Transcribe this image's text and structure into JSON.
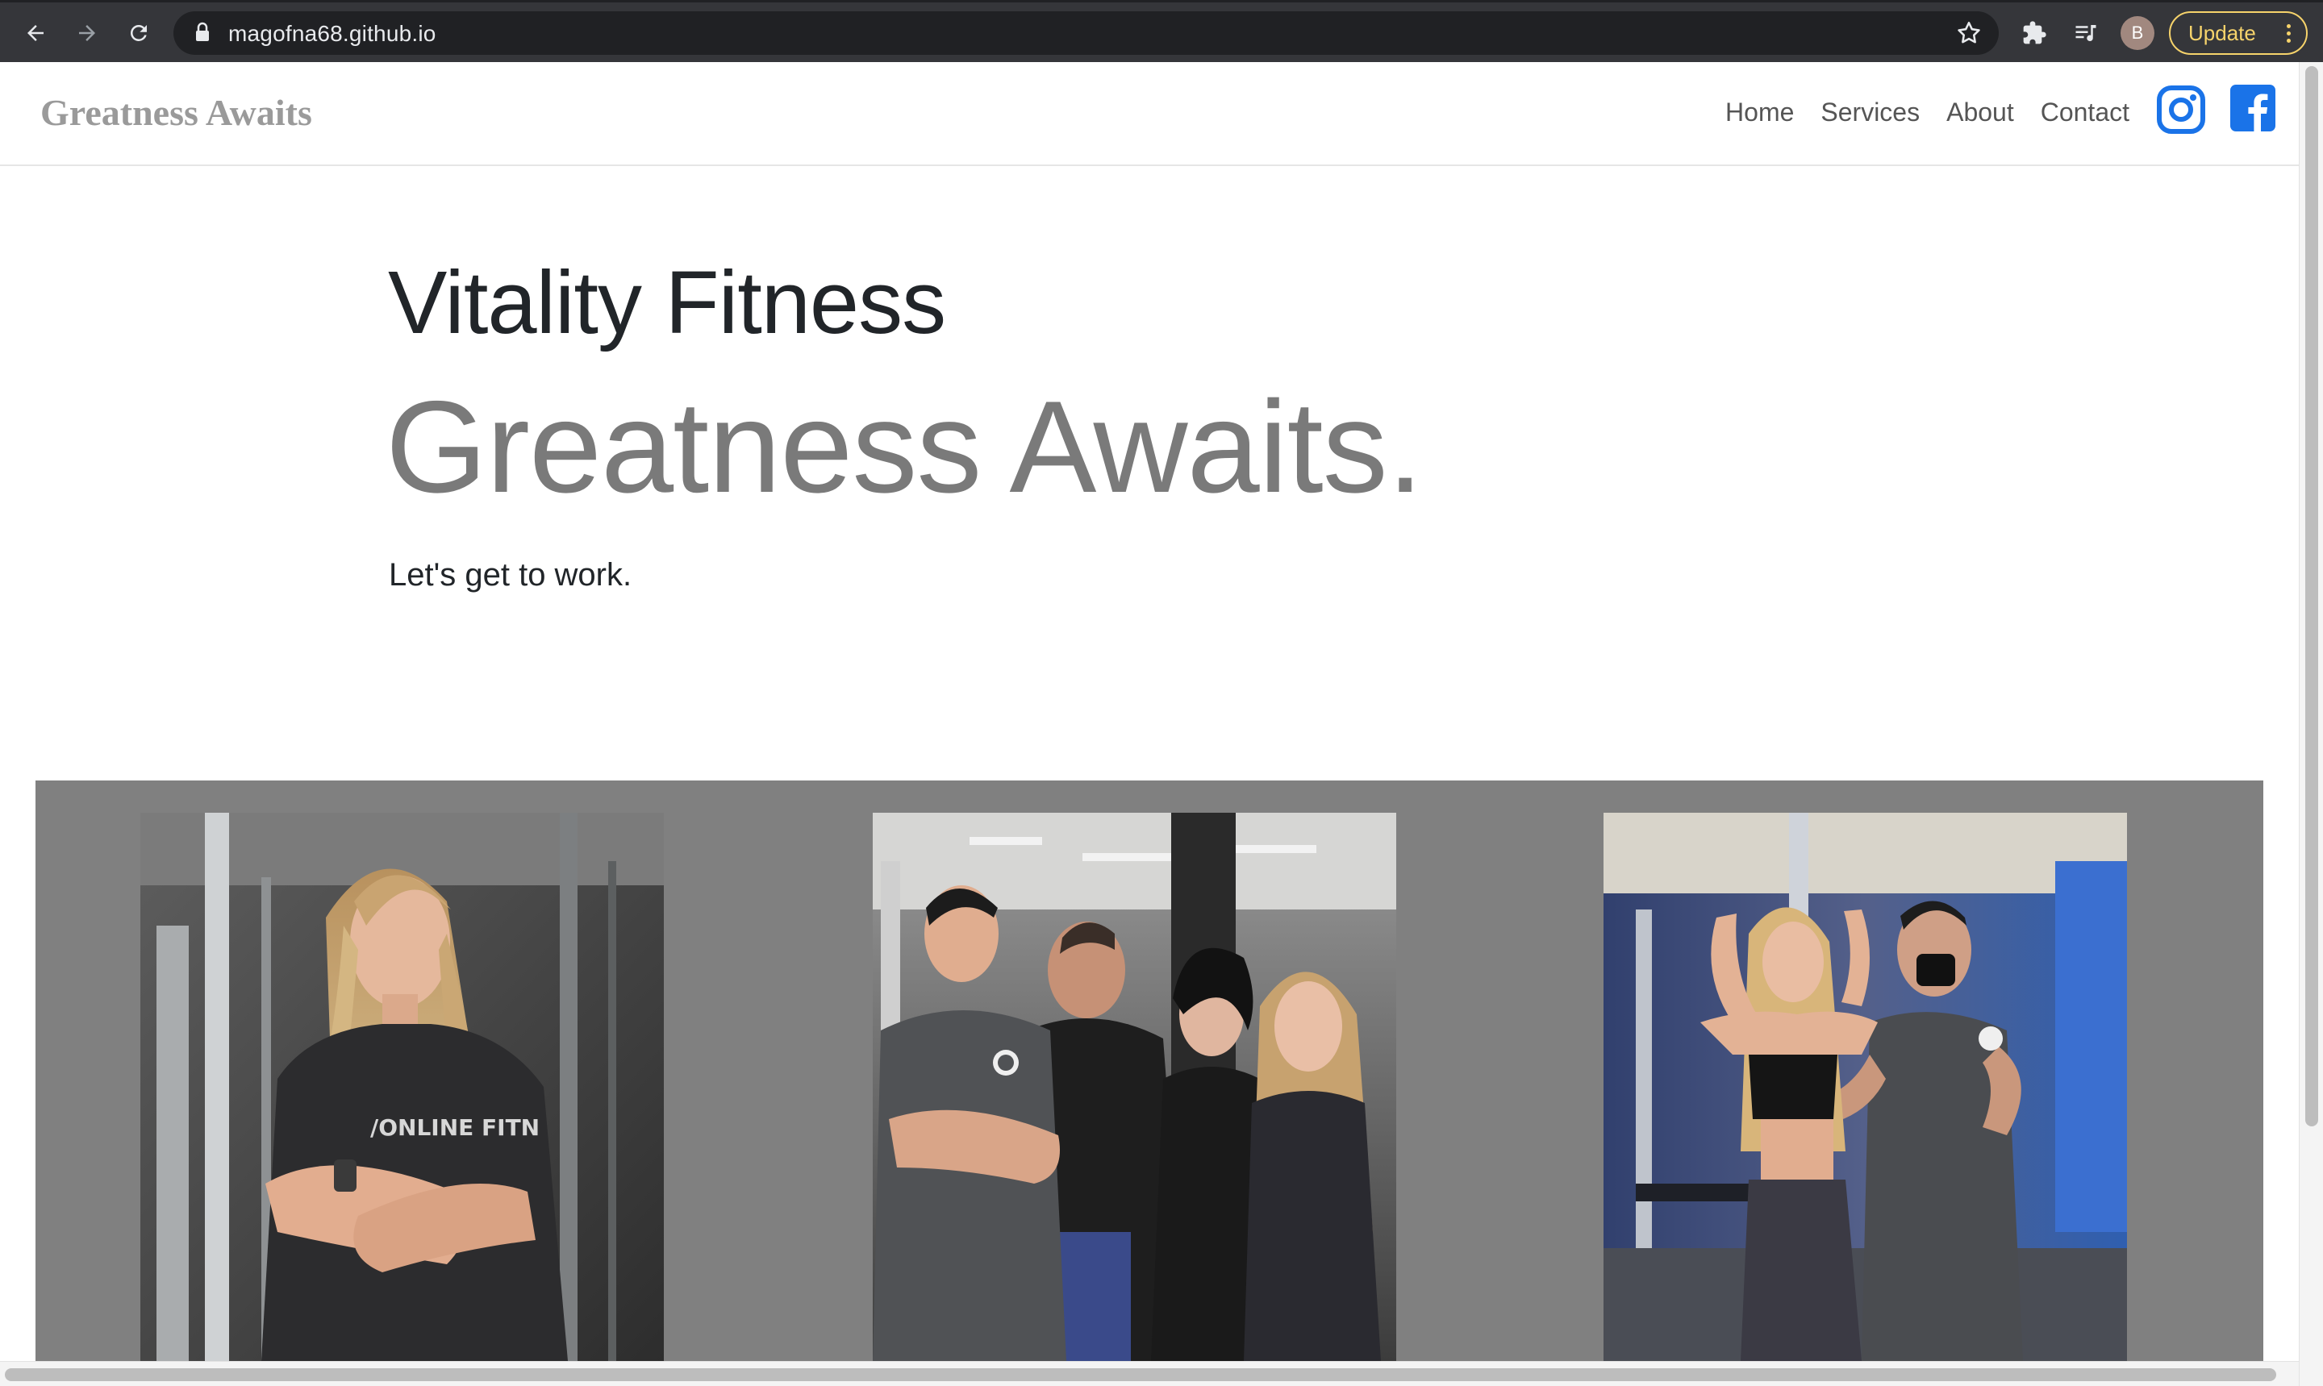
{
  "browser": {
    "url": "magofna68.github.io",
    "profile_initial": "B",
    "update_label": "Update"
  },
  "navbar": {
    "brand": "Greatness Awaits",
    "links": [
      "Home",
      "Services",
      "About",
      "Contact"
    ]
  },
  "hero": {
    "title": "Vitality Fitness",
    "headline": "Greatness Awaits.",
    "subtitle": "Let's get to work."
  },
  "colors": {
    "social_icon": "#1a73e8",
    "gallery_bg": "#808080",
    "brand_text": "#9a9a9a",
    "headline_text": "#7a7a7a"
  },
  "gallery": {
    "photos": [
      {
        "subject": "female trainer arms crossed in gym"
      },
      {
        "subject": "group of four trainers in gym"
      },
      {
        "subject": "trainer posing with client flexing"
      }
    ]
  }
}
